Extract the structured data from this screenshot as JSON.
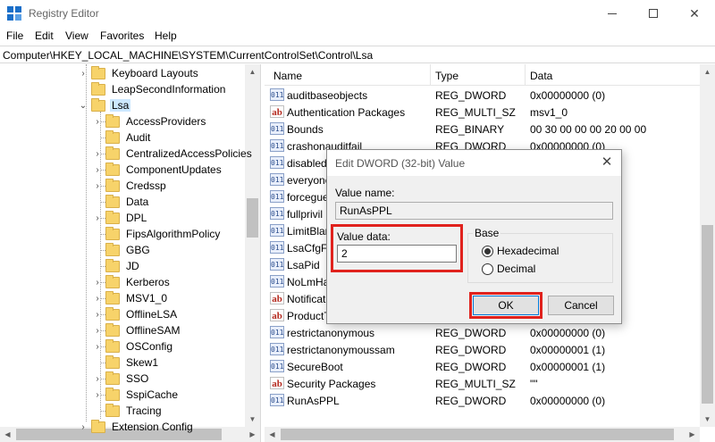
{
  "window": {
    "title": "Registry Editor",
    "min_glyph": "",
    "close_glyph": "✕"
  },
  "menu": [
    "File",
    "Edit",
    "View",
    "Favorites",
    "Help"
  ],
  "address": "Computer\\HKEY_LOCAL_MACHINE\\SYSTEM\\CurrentControlSet\\Control\\Lsa",
  "tree": {
    "parents": [
      "Keyboard Layouts",
      "LeapSecondInformation"
    ],
    "selected": "Lsa",
    "children": [
      "AccessProviders",
      "Audit",
      "CentralizedAccessPolicies",
      "ComponentUpdates",
      "Credssp",
      "Data",
      "DPL",
      "FipsAlgorithmPolicy",
      "GBG",
      "JD",
      "Kerberos",
      "MSV1_0",
      "OfflineLSA",
      "OfflineSAM",
      "OSConfig",
      "Skew1",
      "SSO",
      "SspiCache",
      "Tracing"
    ],
    "children_with_expander": [
      "AccessProviders",
      "CentralizedAccessPolicies",
      "ComponentUpdates",
      "Credssp",
      "DPL",
      "Kerberos",
      "MSV1_0",
      "OfflineLSA",
      "OfflineSAM",
      "OSConfig",
      "SSO",
      "SspiCache"
    ],
    "expand_glyph": "›",
    "collapse_glyph": "⌄",
    "cutoff_row": "Extension Config"
  },
  "list": {
    "columns": [
      "Name",
      "Type",
      "Data"
    ],
    "rows": [
      {
        "icon": "dword",
        "name": "auditbaseobjects",
        "type": "REG_DWORD",
        "data": "0x00000000 (0)"
      },
      {
        "icon": "string",
        "name": "Authentication Packages",
        "type": "REG_MULTI_SZ",
        "data": "msv1_0"
      },
      {
        "icon": "dword",
        "name": "Bounds",
        "type": "REG_BINARY",
        "data": "00 30 00 00 00 20 00 00"
      },
      {
        "icon": "dword",
        "name": "crashonauditfail",
        "type": "REG_DWORD",
        "data": "0x00000000 (0)"
      },
      {
        "icon": "dword",
        "name": "disabled",
        "type": "",
        "data": ""
      },
      {
        "icon": "dword",
        "name": "everyone",
        "type": "",
        "data": ""
      },
      {
        "icon": "dword",
        "name": "forceguest",
        "type": "",
        "data": ""
      },
      {
        "icon": "dword",
        "name": "fullprivil",
        "type": "",
        "data": ""
      },
      {
        "icon": "dword",
        "name": "LimitBlan",
        "type": "",
        "data": ""
      },
      {
        "icon": "dword",
        "name": "LsaCfgFl",
        "type": "",
        "data": ""
      },
      {
        "icon": "dword",
        "name": "LsaPid",
        "type": "",
        "data": ""
      },
      {
        "icon": "dword",
        "name": "NoLmHa",
        "type": "",
        "data": ""
      },
      {
        "icon": "string",
        "name": "Notificat",
        "type": "",
        "data": ""
      },
      {
        "icon": "string",
        "name": "ProductT",
        "type": "",
        "data": ""
      },
      {
        "icon": "dword",
        "name": "restrictanonymous",
        "type": "REG_DWORD",
        "data": "0x00000000 (0)"
      },
      {
        "icon": "dword",
        "name": "restrictanonymoussam",
        "type": "REG_DWORD",
        "data": "0x00000001 (1)"
      },
      {
        "icon": "dword",
        "name": "SecureBoot",
        "type": "REG_DWORD",
        "data": "0x00000001 (1)"
      },
      {
        "icon": "string",
        "name": "Security Packages",
        "type": "REG_MULTI_SZ",
        "data": "\"\""
      },
      {
        "icon": "dword",
        "name": "RunAsPPL",
        "type": "REG_DWORD",
        "data": "0x00000000 (0)"
      }
    ]
  },
  "dialog": {
    "title": "Edit DWORD (32-bit) Value",
    "close_glyph": "✕",
    "value_name_label": "Value name:",
    "value_name": "RunAsPPL",
    "value_data_label": "Value data:",
    "value_data": "2",
    "base_label": "Base",
    "base_options": [
      "Hexadecimal",
      "Decimal"
    ],
    "base_selected": "Hexadecimal",
    "ok_label": "OK",
    "cancel_label": "Cancel",
    "highlight_color": "#e0221d"
  }
}
